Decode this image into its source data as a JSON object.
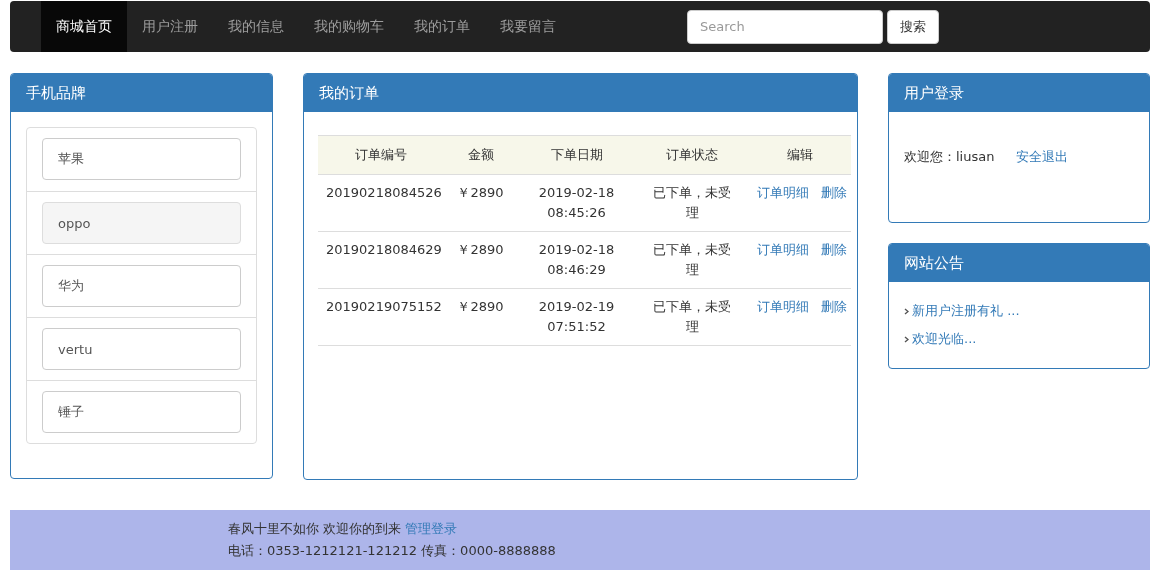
{
  "nav": {
    "items": [
      {
        "label": "商城首页",
        "selected": true
      },
      {
        "label": "用户注册",
        "selected": false
      },
      {
        "label": "我的信息",
        "selected": false
      },
      {
        "label": "我的购物车",
        "selected": false
      },
      {
        "label": "我的订单",
        "selected": false
      },
      {
        "label": "我要留言",
        "selected": false
      }
    ],
    "search": {
      "placeholder": "Search"
    },
    "search_button": "搜索"
  },
  "brands": {
    "title": "手机品牌",
    "items": [
      {
        "label": "苹果",
        "selected": false
      },
      {
        "label": "oppo",
        "selected": true
      },
      {
        "label": "华为",
        "selected": false
      },
      {
        "label": "vertu",
        "selected": false
      },
      {
        "label": "锤子",
        "selected": false
      }
    ]
  },
  "orders": {
    "title": "我的订单",
    "columns": [
      "订单编号",
      "金额",
      "下单日期",
      "订单状态",
      "编辑"
    ],
    "rows": [
      {
        "id": "20190218084526",
        "amount": "￥2890",
        "date": "2019-02-18 08:45:26",
        "status": "已下单，未受理",
        "detail_link": "订单明细",
        "delete_link": "删除"
      },
      {
        "id": "20190218084629",
        "amount": "￥2890",
        "date": "2019-02-18 08:46:29",
        "status": "已下单，未受理",
        "detail_link": "订单明细",
        "delete_link": "删除"
      },
      {
        "id": "20190219075152",
        "amount": "￥2890",
        "date": "2019-02-19 07:51:52",
        "status": "已下单，未受理",
        "detail_link": "订单明细",
        "delete_link": "删除"
      }
    ]
  },
  "login": {
    "title": "用户登录",
    "welcome": "欢迎您：liusan",
    "logout_link": "安全退出"
  },
  "notices": {
    "title": "网站公告",
    "items": [
      "新用户注册有礼 ...",
      "欢迎光临..."
    ]
  },
  "footer": {
    "line1": "春风十里不如你 欢迎你的到来",
    "admin_link": "管理登录",
    "line2": "电话：0353-1212121-121212 传真：0000-8888888"
  }
}
